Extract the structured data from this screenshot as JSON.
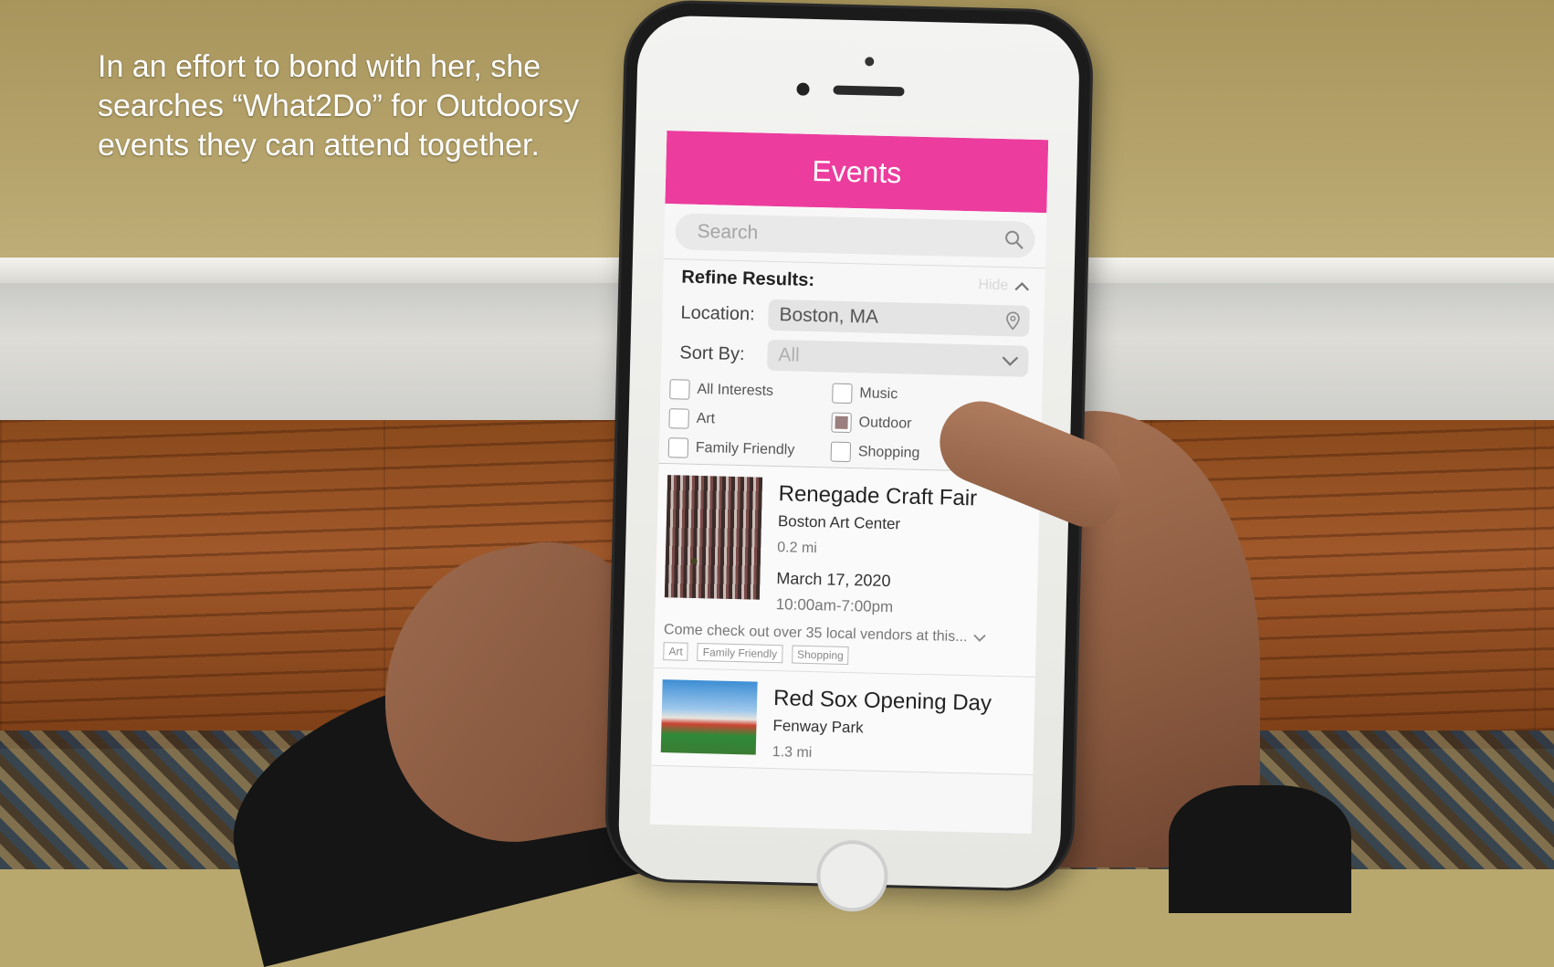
{
  "caption": "In an effort to bond with her, she searches “What2Do” for Outdoorsy events they can attend together.",
  "app": {
    "title": "Events",
    "accent_color": "#ec3c9e",
    "search": {
      "placeholder": "Search"
    },
    "refine": {
      "title": "Refine Results:",
      "hide_label": "Hide",
      "location_label": "Location:",
      "location_value": "Boston, MA",
      "sort_label": "Sort By:",
      "sort_value": "All",
      "interests": [
        {
          "label": "All Interests",
          "checked": false
        },
        {
          "label": "Music",
          "checked": false
        },
        {
          "label": "Art",
          "checked": false
        },
        {
          "label": "Outdoor",
          "checked": true
        },
        {
          "label": "Family Friendly",
          "checked": false
        },
        {
          "label": "Shopping",
          "checked": false
        }
      ]
    },
    "events": [
      {
        "name": "Renegade Craft Fair",
        "venue": "Boston Art Center",
        "distance": "0.2 mi",
        "date": "March 17, 2020",
        "time": "10:00am-7:00pm",
        "description": "Come check out over 35 local vendors at this...",
        "tags": [
          "Art",
          "Family Friendly",
          "Shopping"
        ]
      },
      {
        "name": "Red Sox Opening Day",
        "venue": "Fenway Park",
        "distance": "1.3 mi"
      }
    ]
  }
}
